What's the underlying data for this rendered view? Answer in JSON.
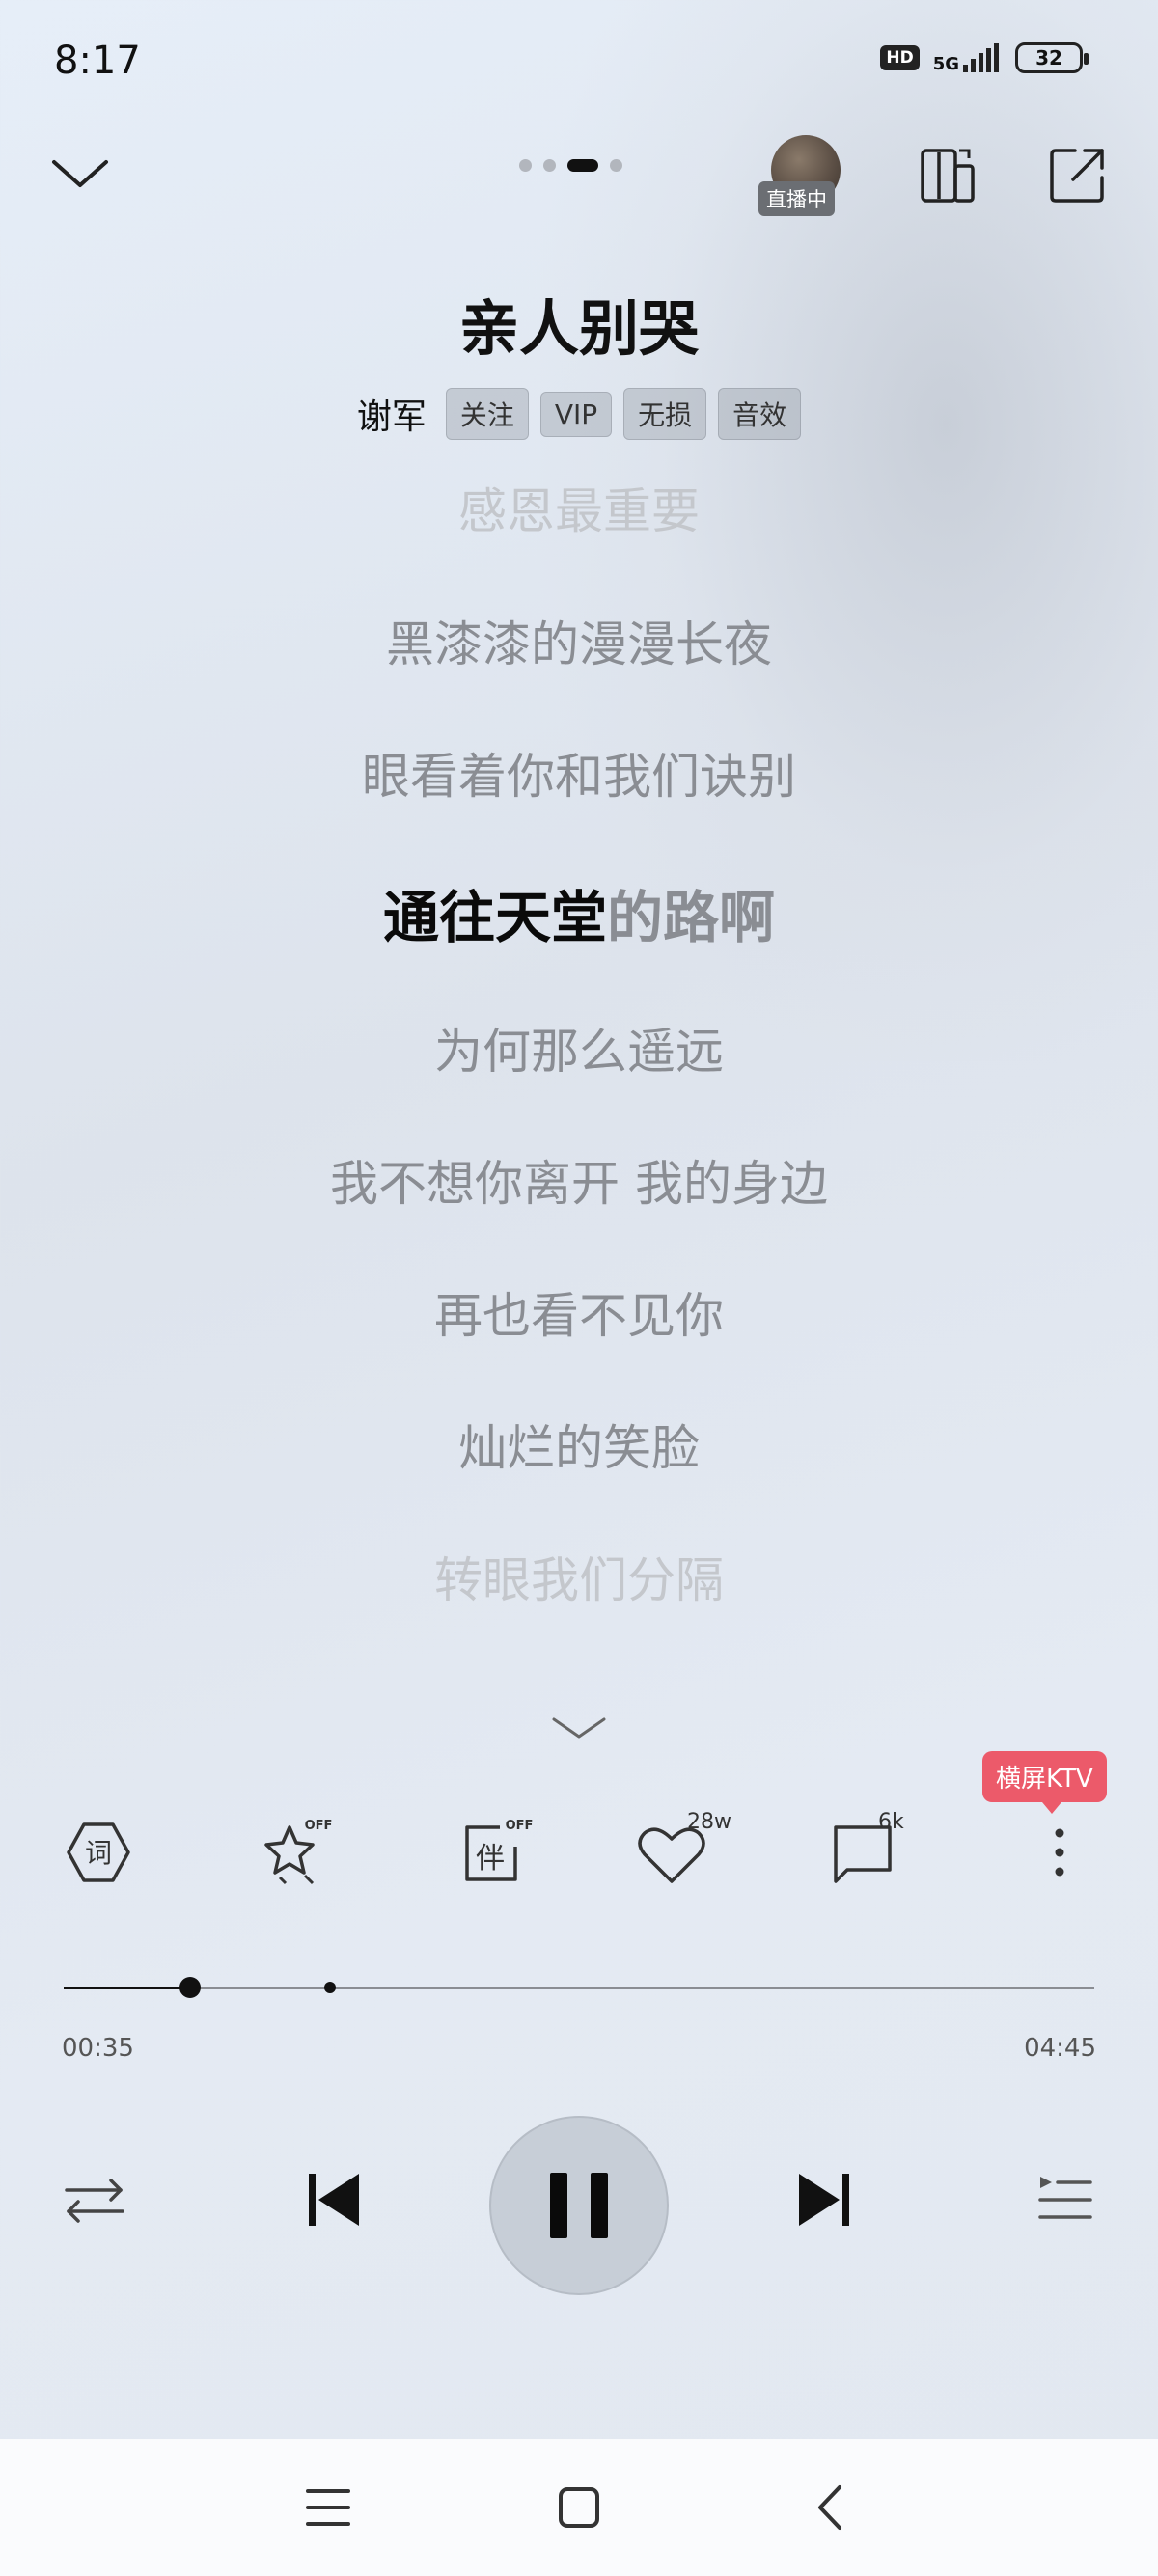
{
  "status_bar": {
    "time": "8:17",
    "hd": "HD",
    "network": "5G",
    "battery": "32"
  },
  "header": {
    "live_badge": "直播中",
    "pager": {
      "count": 4,
      "active_index": 2
    }
  },
  "song": {
    "title": "亲人别哭",
    "artist": "谢军",
    "tags": [
      "关注",
      "VIP",
      "无损",
      "音效"
    ]
  },
  "lyrics": {
    "lines": [
      "感恩最重要",
      "黑漆漆的漫漫长夜",
      "眼看着你和我们诀别",
      "通往天堂的路啊",
      "为何那么遥远",
      "我不想你离开 我的身边",
      "再也看不见你",
      "灿烂的笑脸",
      "转眼我们分隔"
    ],
    "current_sung": "通往天堂",
    "current_rest": "的路啊"
  },
  "actions": {
    "lyrics_icon_text": "词",
    "favorite_off": "OFF",
    "accompaniment_text": "伴",
    "accompaniment_off": "OFF",
    "like_count": "28w",
    "comment_count": "6k",
    "ktv_badge": "横屏KTV"
  },
  "progress": {
    "current": "00:35",
    "total": "04:45",
    "played_fraction": 0.123,
    "buffered_fraction": 0.258
  },
  "icons": {
    "collapse": "chevron-down-icon",
    "device": "device-switch-icon",
    "share": "share-icon",
    "repeat": "shuffle-repeat-icon",
    "prev": "previous-icon",
    "pause": "pause-icon",
    "next": "next-icon",
    "playlist": "playlist-icon"
  }
}
